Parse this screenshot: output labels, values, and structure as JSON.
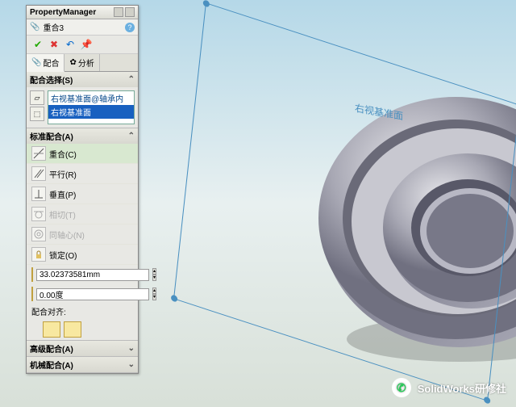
{
  "header": {
    "title": "PropertyManager"
  },
  "feature": {
    "name": "重合3"
  },
  "tabs": {
    "mates": "配合",
    "analysis": "分析"
  },
  "selections": {
    "head": "配合选择(S)",
    "items": [
      "右视基准面@轴承内",
      "右视基准面"
    ]
  },
  "standard": {
    "head": "标准配合(A)",
    "coincident": "重合(C)",
    "parallel": "平行(R)",
    "perpendicular": "垂直(P)",
    "tangent": "相切(T)",
    "concentric": "同轴心(N)",
    "lock": "锁定(O)",
    "distance_val": "33.02373581mm",
    "angle_val": "0.00度",
    "align_label": "配合对齐:"
  },
  "advanced": {
    "head": "高级配合(A)"
  },
  "mech": {
    "head": "机械配合(A)"
  },
  "viewport": {
    "plane_label": "右视基准面"
  },
  "watermark": {
    "text": "SolidWorks研修社"
  }
}
